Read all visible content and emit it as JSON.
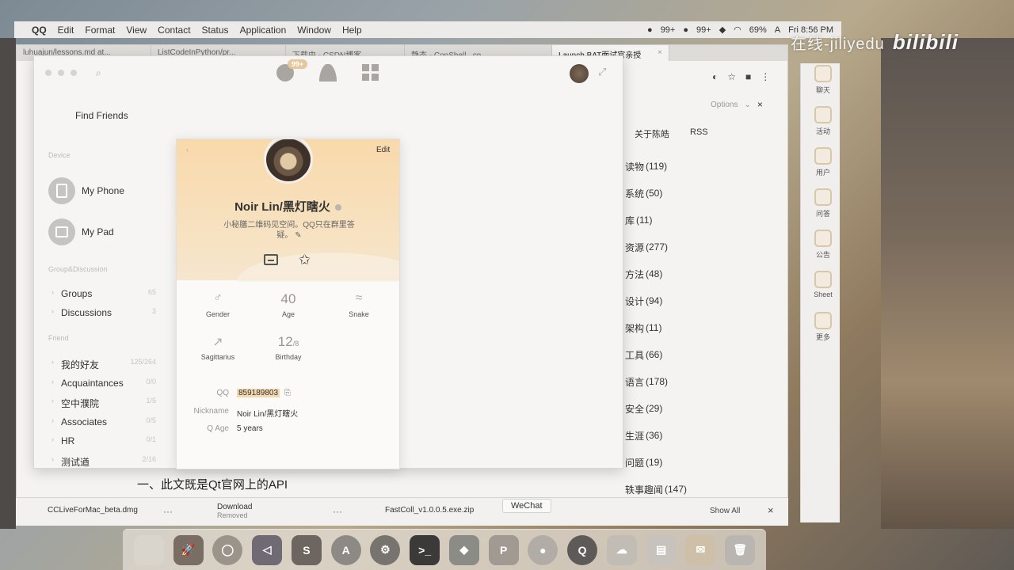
{
  "menubar": {
    "app_name": "QQ",
    "items": [
      "Edit",
      "Format",
      "View",
      "Contact",
      "Status",
      "Application",
      "Window",
      "Help"
    ],
    "badge1": "99+",
    "badge2": "99+",
    "battery": "69%",
    "input": "A",
    "clock": "Fri 8:56 PM"
  },
  "watermark": {
    "text": "在线-jiliyedu",
    "logo": "bilibili"
  },
  "browser": {
    "tabs": [
      "luhuajun/lessons.md at...",
      "ListCodeInPython/pr...",
      "下载中 - CSDN博客",
      "静态 - ConShell...cn",
      "Launch BAT面试官亲授"
    ],
    "find_options": "Options",
    "nav": [
      "关于陈皓",
      "RSS"
    ],
    "categories": [
      {
        "name": "读物",
        "count": "(119)"
      },
      {
        "name": "系统",
        "count": "(50)"
      },
      {
        "name": "库",
        "count": "(11)"
      },
      {
        "name": "资源",
        "count": "(277)"
      },
      {
        "name": "方法",
        "count": "(48)"
      },
      {
        "name": "设计",
        "count": "(94)"
      },
      {
        "name": "架构",
        "count": "(11)"
      },
      {
        "name": "工具",
        "count": "(66)"
      },
      {
        "name": "语言",
        "count": "(178)"
      },
      {
        "name": "安全",
        "count": "(29)"
      },
      {
        "name": "生涯",
        "count": "(36)"
      },
      {
        "name": "问题",
        "count": "(19)"
      },
      {
        "name": "轶事趣闻",
        "count": "(147)"
      }
    ],
    "article_line": "一、此文既是Qt官网上的API"
  },
  "downloads": {
    "item1": "CCLiveForMac_beta.dmg",
    "item2_title": "Download",
    "item2_status": "Removed",
    "item3": "FastColl_v1.0.0.5.exe.zip",
    "show_all": "Show All",
    "tag": "WeChat"
  },
  "right_sidebar": [
    "聊天",
    "活动",
    "用户",
    "问答",
    "公告",
    "Sheet",
    "更多"
  ],
  "qq": {
    "msg_badge": "99+",
    "find_friends": "Find Friends",
    "section_device": "Device",
    "devices": [
      "My Phone",
      "My Pad"
    ],
    "section_groups": "Group&Discussion",
    "groups": [
      {
        "name": "Groups",
        "count": "65"
      },
      {
        "name": "Discussions",
        "count": "3"
      }
    ],
    "section_friend": "Friend",
    "friends": [
      {
        "name": "我的好友",
        "count": "125/264"
      },
      {
        "name": "Acquaintances",
        "count": "0/0"
      },
      {
        "name": "空中濮院",
        "count": "1/5"
      },
      {
        "name": "Associates",
        "count": "0/5"
      },
      {
        "name": "HR",
        "count": "0/1"
      },
      {
        "name": "测试遒",
        "count": "2/16"
      }
    ]
  },
  "profile": {
    "edit": "Edit",
    "name": "Noir Lin/黑灯瞎火",
    "signature": "小秘膳二维码见空间。QQ只在群里答疑。",
    "gender_label": "Gender",
    "age_value": "40",
    "age_label": "Age",
    "zodiac_label": "Snake",
    "sign_label": "Sagittarius",
    "birthday_value": "12",
    "birthday_sub": "/8",
    "birthday_label": "Birthday",
    "qq_key": "QQ",
    "qq_value": "859189803",
    "nick_key": "Nickname",
    "nick_value": "Noir Lin/黑灯瞎火",
    "qage_key": "Q Age",
    "qage_value": "5 years"
  }
}
